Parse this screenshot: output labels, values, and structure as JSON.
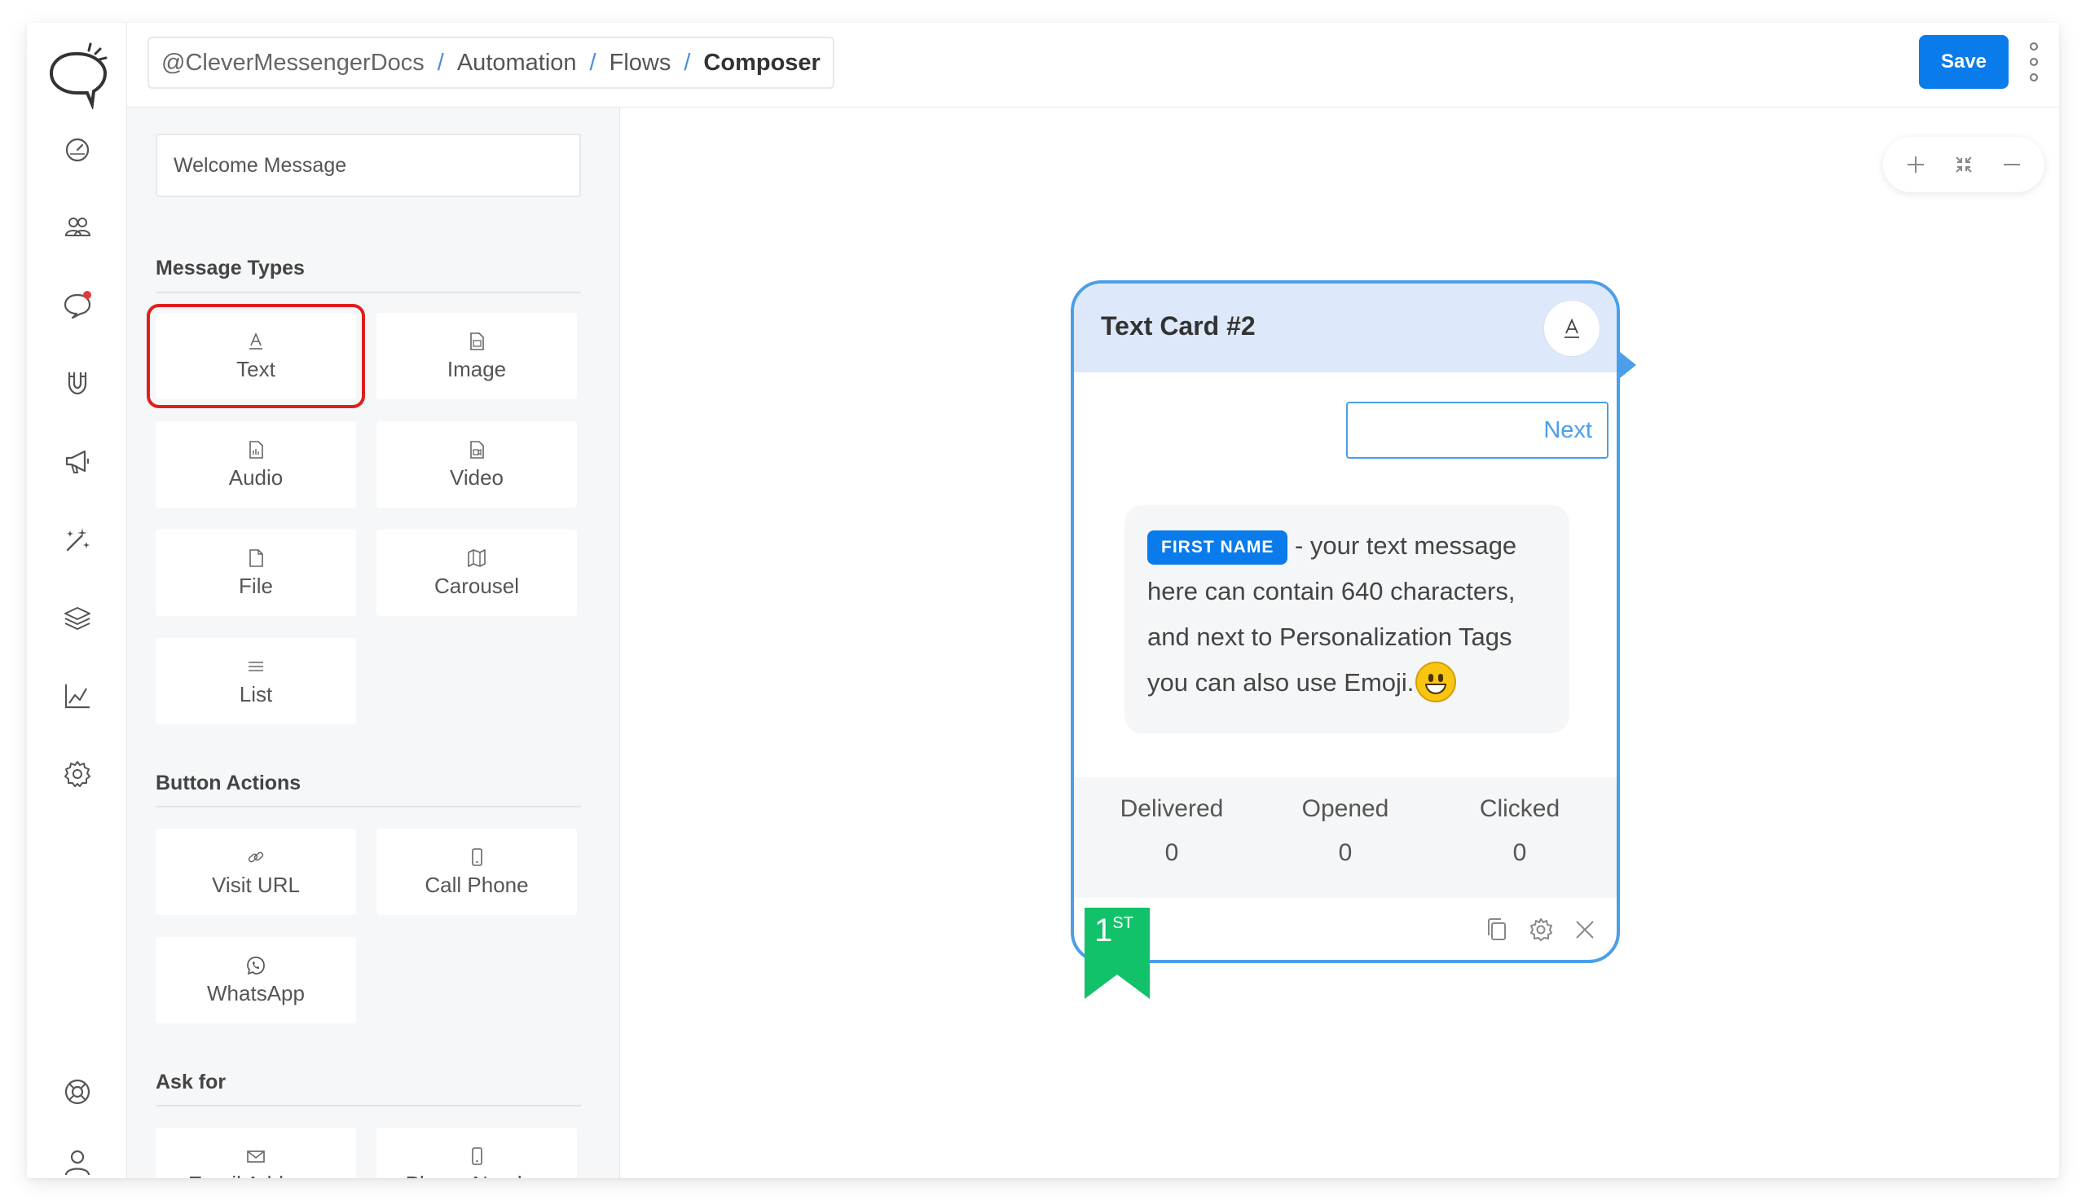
{
  "breadcrumb": {
    "root": "@CleverMessengerDocs",
    "items": [
      "Automation",
      "Flows"
    ],
    "current": "Composer",
    "separator": "/"
  },
  "toolbar": {
    "save_label": "Save"
  },
  "rail_icons": [
    "dashboard-icon",
    "audience-icon",
    "live-chat-icon",
    "growth-tools-icon",
    "broadcast-icon",
    "automation-icon",
    "templates-icon",
    "analytics-icon",
    "settings-icon",
    "help-icon",
    "account-icon"
  ],
  "panel": {
    "flow_name_value": "Welcome Message",
    "message_types_title": "Message Types",
    "message_types": [
      {
        "label": "Text",
        "icon": "text-icon"
      },
      {
        "label": "Image",
        "icon": "image-icon"
      },
      {
        "label": "Audio",
        "icon": "audio-icon"
      },
      {
        "label": "Video",
        "icon": "video-icon"
      },
      {
        "label": "File",
        "icon": "file-icon"
      },
      {
        "label": "Carousel",
        "icon": "carousel-icon"
      },
      {
        "label": "List",
        "icon": "list-icon"
      }
    ],
    "button_actions_title": "Button Actions",
    "button_actions": [
      {
        "label": "Visit URL",
        "icon": "link-icon"
      },
      {
        "label": "Call Phone",
        "icon": "phone-icon"
      },
      {
        "label": "WhatsApp",
        "icon": "whatsapp-icon"
      }
    ],
    "ask_for_title": "Ask for",
    "ask_for": [
      {
        "label": "Email Address",
        "icon": "envelope-icon"
      },
      {
        "label": "Phone Number",
        "icon": "phone-icon"
      }
    ]
  },
  "card": {
    "title": "Text Card #2",
    "next_label": "Next",
    "tag": "FIRST NAME",
    "message_line1": "- your text message",
    "message_line2": "here can contain 640 characters,",
    "message_line3": "and next to Personalization Tags",
    "message_line4": "you can also use Emoji.",
    "stats": [
      {
        "label": "Delivered",
        "value": "0"
      },
      {
        "label": "Opened",
        "value": "0"
      },
      {
        "label": "Clicked",
        "value": "0"
      }
    ],
    "badge_number": "1",
    "badge_suffix": "ST"
  },
  "colors": {
    "accent": "#0a7bea",
    "card_border": "#4b9fe8",
    "card_header": "#dde9fa",
    "badge": "#12c26b",
    "highlight": "#e01e1e"
  }
}
